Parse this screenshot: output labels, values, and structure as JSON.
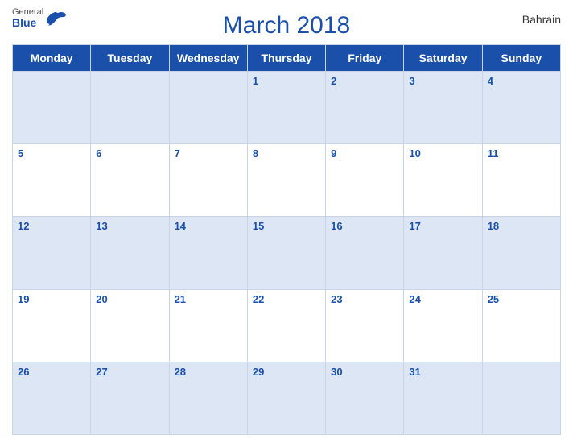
{
  "header": {
    "title": "March 2018",
    "country": "Bahrain",
    "logo": {
      "general": "General",
      "blue": "Blue"
    }
  },
  "weekdays": [
    "Monday",
    "Tuesday",
    "Wednesday",
    "Thursday",
    "Friday",
    "Saturday",
    "Sunday"
  ],
  "weeks": [
    [
      "",
      "",
      "",
      "1",
      "2",
      "3",
      "4"
    ],
    [
      "5",
      "6",
      "7",
      "8",
      "9",
      "10",
      "11"
    ],
    [
      "12",
      "13",
      "14",
      "15",
      "16",
      "17",
      "18"
    ],
    [
      "19",
      "20",
      "21",
      "22",
      "23",
      "24",
      "25"
    ],
    [
      "26",
      "27",
      "28",
      "29",
      "30",
      "31",
      ""
    ]
  ],
  "colors": {
    "header_bg": "#1a4faa",
    "odd_row": "#dce6f5",
    "even_row": "#ffffff",
    "day_num": "#1a4faa"
  }
}
